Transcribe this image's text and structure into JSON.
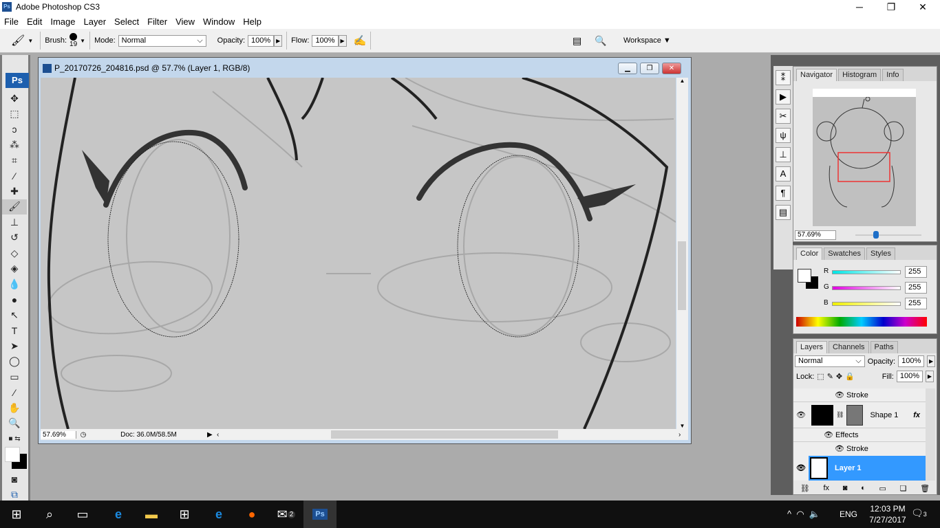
{
  "app": {
    "title": "Adobe Photoshop CS3",
    "logo": "Ps"
  },
  "menu": [
    "File",
    "Edit",
    "Image",
    "Layer",
    "Select",
    "Filter",
    "View",
    "Window",
    "Help"
  ],
  "options": {
    "brush_label": "Brush:",
    "brush_size": "19",
    "mode_label": "Mode:",
    "mode_value": "Normal",
    "opacity_label": "Opacity:",
    "opacity_value": "100%",
    "flow_label": "Flow:",
    "flow_value": "100%",
    "workspace_label": "Workspace"
  },
  "document": {
    "title": "P_20170726_204816.psd @ 57.7% (Layer 1, RGB/8)",
    "zoom": "57.69%",
    "doc_size": "Doc: 36.0M/58.5M"
  },
  "navigator": {
    "tabs": [
      "Navigator",
      "Histogram",
      "Info"
    ],
    "zoom": "57.69%"
  },
  "color": {
    "tabs": [
      "Color",
      "Swatches",
      "Styles"
    ],
    "channels": [
      {
        "label": "R",
        "value": "255",
        "color": "#00e5e5"
      },
      {
        "label": "G",
        "value": "255",
        "color": "#e000e0"
      },
      {
        "label": "B",
        "value": "255",
        "color": "#f0f000"
      }
    ]
  },
  "layers": {
    "tabs": [
      "Layers",
      "Channels",
      "Paths"
    ],
    "blend": "Normal",
    "opacity_label": "Opacity:",
    "opacity": "100%",
    "lock_label": "Lock:",
    "fill_label": "Fill:",
    "fill": "100%",
    "rows": {
      "stroke_top": "Stroke",
      "shape": "Shape 1",
      "effects": "Effects",
      "stroke": "Stroke",
      "layer1": "Layer 1"
    }
  },
  "taskbar": {
    "time": "12:03 PM",
    "date": "7/27/2017",
    "lang": "ENG",
    "mail_badge": "2",
    "notif_badge": "3",
    "ps_label": "Ps"
  },
  "colors": {
    "accent": "#3399ff",
    "ps_blue": "#1d4f91"
  }
}
